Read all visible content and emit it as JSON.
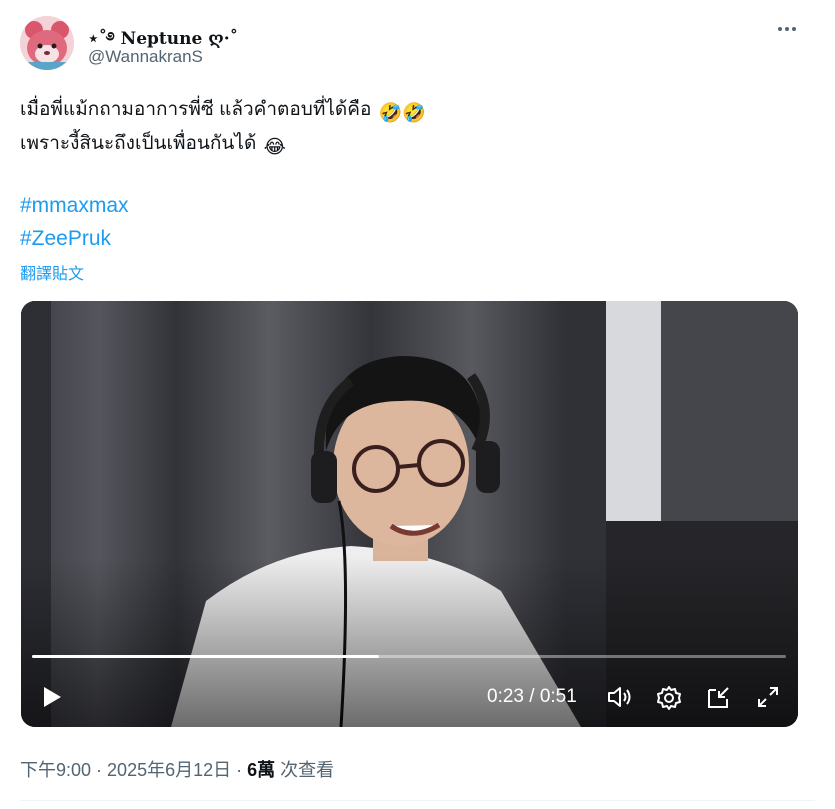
{
  "author": {
    "display_name": "⋆˚࿔ 𝐍𝐞𝐩𝐭𝐮𝐧𝐞 ღ·˚",
    "handle": "@WannakranS",
    "avatar_icon": "pink-bear-avatar"
  },
  "post": {
    "line1": "เมื่อพี่แม้กถามอาการพี่ซี แล้วคำตอบที่ได้คือ",
    "line1_emoji": "🤣🤣",
    "line2": "เพราะงี้สินะถึงเป็นเพื่อนกันได้",
    "line2_emoji": "😂",
    "hashtags": [
      "#mmaxmax",
      "#ZeePruk"
    ],
    "translate_label": "翻譯貼文"
  },
  "video": {
    "current_time": "0:23",
    "separator": " / ",
    "duration": "0:51",
    "progress": 0.46,
    "icons": [
      "play-icon",
      "volume-icon",
      "settings-gear-icon",
      "pip-icon",
      "fullscreen-icon"
    ]
  },
  "meta": {
    "time": "下午9:00",
    "sep1": " · ",
    "date": "2025年6月12日",
    "sep2": " · ",
    "views_count": "6萬",
    "views_label": " 次查看"
  },
  "colors": {
    "link": "#1d9bf0",
    "text": "#0f1419",
    "secondary": "#536471"
  }
}
